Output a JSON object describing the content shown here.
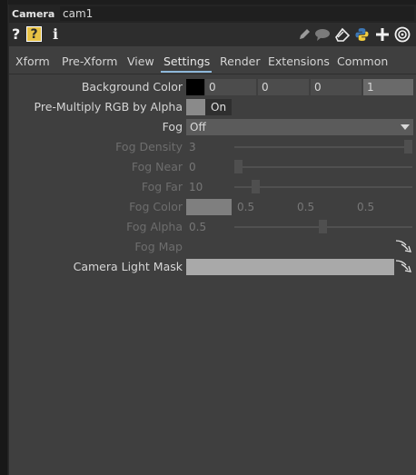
{
  "titlebar": {
    "op_type": "Camera",
    "op_name": "cam1"
  },
  "toolbar": {
    "help": "?",
    "op_help": "?",
    "info": "i"
  },
  "tabs": [
    {
      "label": "Xform"
    },
    {
      "label": "Pre-Xform"
    },
    {
      "label": "View"
    },
    {
      "label": "Settings"
    },
    {
      "label": "Render"
    },
    {
      "label": "Extensions"
    },
    {
      "label": "Common"
    }
  ],
  "params": {
    "bgcolor": {
      "label": "Background Color",
      "r": "0",
      "g": "0",
      "b": "0",
      "a": "1",
      "swatch": "#000000"
    },
    "premult": {
      "label": "Pre-Multiply RGB by Alpha",
      "value": "On"
    },
    "fog": {
      "label": "Fog",
      "value": "Off"
    },
    "fogdensity": {
      "label": "Fog Density",
      "value": "3"
    },
    "fognear": {
      "label": "Fog Near",
      "value": "0"
    },
    "fogfar": {
      "label": "Fog Far",
      "value": "10"
    },
    "fogcolor": {
      "label": "Fog Color",
      "g": "0.5",
      "b": "0.5",
      "a": "0.5",
      "swatch": "#7f7f7f"
    },
    "fogalpha": {
      "label": "Fog Alpha",
      "value": "0.5"
    },
    "fogmap": {
      "label": "Fog Map"
    },
    "lightmask": {
      "label": "Camera Light Mask",
      "value": ""
    }
  },
  "colors": {
    "accent_tab": "#8eb7d9",
    "panel_bg": "#3f3f3f",
    "op_help_bg": "#e8c245"
  }
}
